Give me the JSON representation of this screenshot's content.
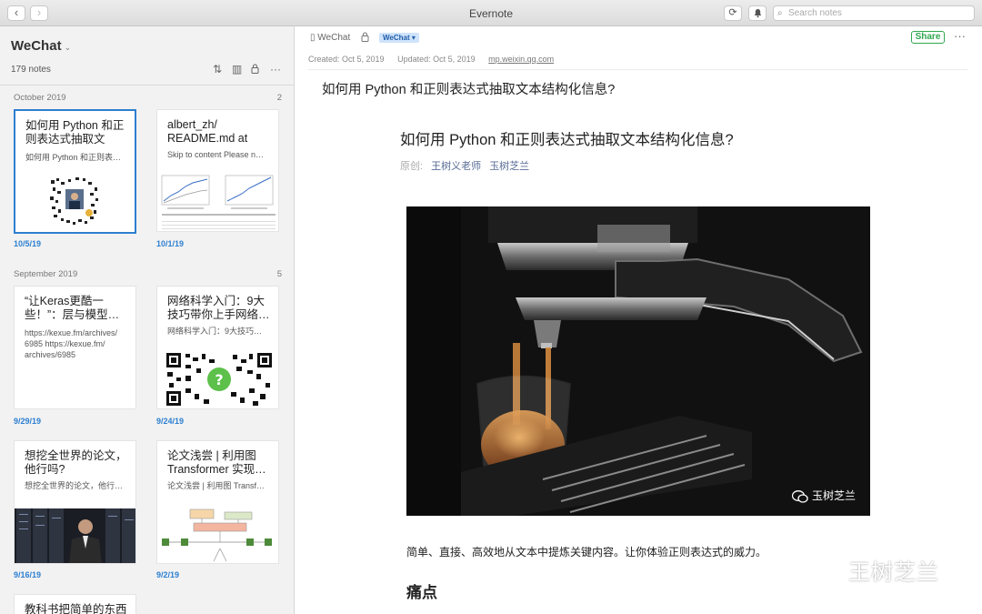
{
  "window": {
    "title": "Evernote",
    "search_placeholder": "Search notes",
    "back_glyph": "‹",
    "forward_glyph": "›",
    "sync_glyph": "⟳",
    "bell_glyph": "🔔"
  },
  "sidebar": {
    "notebook": "WeChat",
    "count": "179 notes",
    "tools": [
      "⇅",
      "▥",
      "🔒",
      "···"
    ],
    "sections": [
      {
        "month": "October 2019",
        "count": "2",
        "notes": [
          {
            "title": "如何用 Python 和正则表达式抽取文本…",
            "snippet": "如何用 Python 和正则表…",
            "date": "10/5/19",
            "thumb": "qr-portrait"
          },
          {
            "title": "albert_zh/ README.md at ma…",
            "snippet": "Skip to content Please n…",
            "date": "10/1/19",
            "thumb": "paper-charts"
          }
        ]
      },
      {
        "month": "September 2019",
        "count": "5",
        "notes": [
          {
            "title": "“让Keras更酷一些！”：层与模型…",
            "snippet": "https://kexue.fm/archives/ 6985 https://kexue.fm/ archives/6985",
            "date": "9/29/19",
            "thumb": "none"
          },
          {
            "title": "网络科学入门：9大技巧带你上手网络…",
            "snippet": "网络科学入门：9大技巧…",
            "date": "9/24/19",
            "thumb": "qr"
          },
          {
            "title": "想挖全世界的论文，他行吗?",
            "snippet": "想挖全世界的论文，他行…",
            "date": "9/16/19",
            "thumb": "server-room"
          },
          {
            "title": "论文浅尝 | 利用图 Transformer 实现…",
            "snippet": "论文浅尝 | 利用图 Transf…",
            "date": "9/2/19",
            "thumb": "diagram"
          },
          {
            "title": "教科书把简单的东西",
            "snippet": "",
            "date": "",
            "thumb": "none"
          }
        ]
      }
    ]
  },
  "note": {
    "notebook": "WeChat",
    "tag": "WeChat",
    "share": "Share",
    "more": "···",
    "created": "Created: Oct 5, 2019",
    "updated": "Updated: Oct 5, 2019",
    "source": "mp.weixin.qq.com",
    "title": "如何用 Python 和正则表达式抽取文本结构化信息?",
    "article": {
      "title": "如何用 Python 和正则表达式抽取文本结构化信息?",
      "byline_label": "原创:",
      "authors": [
        "王树义老师",
        "玉树芝兰"
      ],
      "image_watermark": "玉树芝兰",
      "lead": "简单、直接、高效地从文本中提炼关键内容。让你体验正则表达式的威力。",
      "heading": "痛点"
    },
    "page_watermark": "王树芝兰"
  }
}
